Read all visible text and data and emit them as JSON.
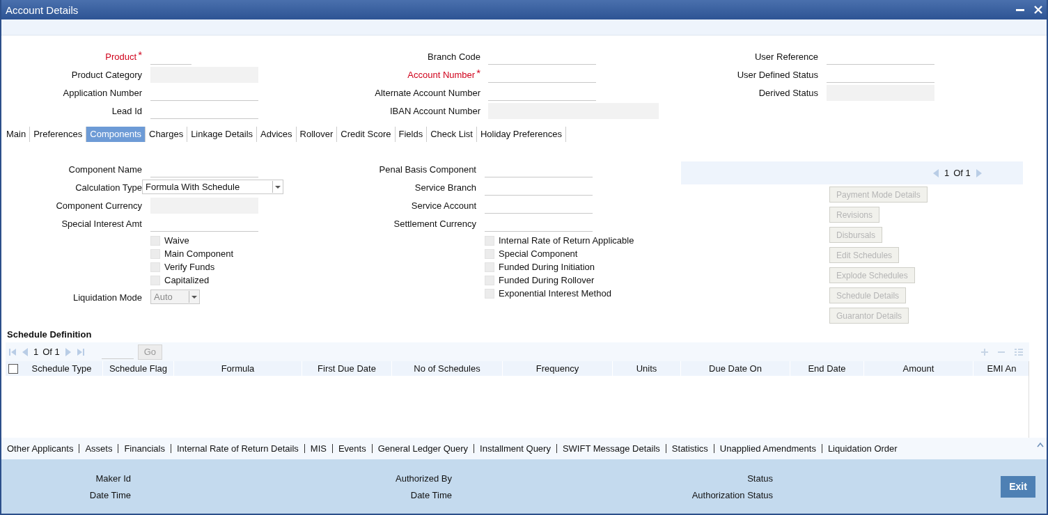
{
  "window": {
    "title": "Account Details"
  },
  "header": {
    "columns": [
      {
        "rows": [
          {
            "label": "Product",
            "mark": "*",
            "required": true,
            "disabled": false
          },
          {
            "label": "Product Category",
            "required": false,
            "disabled": true
          },
          {
            "label": "Application Number",
            "required": false,
            "disabled": false
          },
          {
            "label": "Lead Id",
            "required": false,
            "disabled": false
          }
        ]
      },
      {
        "rows": [
          {
            "label": "Branch Code",
            "required": false,
            "disabled": false
          },
          {
            "label": "Account Number",
            "mark": "*",
            "required": true,
            "disabled": false
          },
          {
            "label": "Alternate Account Number",
            "required": false,
            "disabled": false
          },
          {
            "label": "IBAN Account Number",
            "required": false,
            "disabled": true
          }
        ]
      },
      {
        "rows": [
          {
            "label": "User Reference",
            "required": false,
            "disabled": false
          },
          {
            "label": "User Defined Status",
            "required": false,
            "disabled": false
          },
          {
            "label": "Derived Status",
            "required": false,
            "disabled": true
          }
        ]
      }
    ]
  },
  "tabs": [
    {
      "label": "Main",
      "selected": false
    },
    {
      "label": "Preferences",
      "selected": false
    },
    {
      "label": "Components",
      "selected": true
    },
    {
      "label": "Charges",
      "selected": false
    },
    {
      "label": "Linkage Details",
      "selected": false
    },
    {
      "label": "Advices",
      "selected": false
    },
    {
      "label": "Rollover",
      "selected": false
    },
    {
      "label": "Credit Score",
      "selected": false
    },
    {
      "label": "Fields",
      "selected": false
    },
    {
      "label": "Check List",
      "selected": false
    },
    {
      "label": "Holiday Preferences",
      "selected": false
    }
  ],
  "components": {
    "left": [
      {
        "kind": "text",
        "label": "Component Name",
        "disabled": false
      },
      {
        "kind": "select",
        "label": "Calculation Type",
        "value": "Formula With Schedule",
        "disabled": false
      },
      {
        "kind": "text",
        "label": "Component Currency",
        "disabled": true
      },
      {
        "kind": "text",
        "label": "Special Interest Amt",
        "disabled": false
      },
      {
        "kind": "checkbox",
        "label": "Waive",
        "checked": false
      },
      {
        "kind": "checkbox",
        "label": "Main Component",
        "checked": false
      },
      {
        "kind": "checkbox",
        "label": "Verify Funds",
        "checked": false
      },
      {
        "kind": "checkbox",
        "label": "Capitalized",
        "checked": false
      },
      {
        "kind": "select",
        "label": "Liquidation Mode",
        "value": "Auto",
        "disabled": true
      }
    ],
    "middle": [
      {
        "kind": "text",
        "label": "Penal Basis Component",
        "disabled": false
      },
      {
        "kind": "text",
        "label": "Service Branch",
        "disabled": false
      },
      {
        "kind": "text",
        "label": "Service Account",
        "disabled": false
      },
      {
        "kind": "text",
        "label": "Settlement Currency",
        "disabled": false
      },
      {
        "kind": "checkbox",
        "label": "Internal Rate of Return Applicable",
        "checked": false
      },
      {
        "kind": "checkbox",
        "label": "Special Component",
        "checked": false
      },
      {
        "kind": "checkbox",
        "label": "Funded During Initiation",
        "checked": false
      },
      {
        "kind": "checkbox",
        "label": "Funded During Rollover",
        "checked": false
      },
      {
        "kind": "checkbox",
        "label": "Exponential Interest Method",
        "checked": false
      }
    ],
    "pager": {
      "current": "1",
      "of": "Of 1"
    },
    "buttons": [
      {
        "label": "Payment Mode Details",
        "disabled": true
      },
      {
        "label": "Revisions",
        "disabled": true
      },
      {
        "label": "Disbursals",
        "disabled": true
      },
      {
        "label": "Edit Schedules",
        "disabled": true
      },
      {
        "label": "Explode Schedules",
        "disabled": true
      },
      {
        "label": "Schedule Details",
        "disabled": true
      },
      {
        "label": "Guarantor Details",
        "disabled": true
      }
    ]
  },
  "schedule_definition": {
    "title": "Schedule Definition",
    "pager": {
      "current": "1",
      "of": "Of 1"
    },
    "go_button": "Go",
    "select_all_checked": false,
    "columns": [
      "Schedule Type",
      "Schedule Flag",
      "Formula",
      "First Due Date",
      "No of Schedules",
      "Frequency",
      "Units",
      "Due Date On",
      "End Date",
      "Amount",
      "EMI An"
    ]
  },
  "links": [
    "Other Applicants",
    "Assets",
    "Financials",
    "Internal Rate of Return Details",
    "MIS",
    "Events",
    "General Ledger Query",
    "Installment Query",
    "SWIFT Message Details",
    "Statistics",
    "Unapplied Amendments",
    "Liquidation Order"
  ],
  "audit": [
    [
      {
        "label": "Maker Id"
      },
      {
        "label": "Date Time"
      }
    ],
    [
      {
        "label": "Authorized By"
      },
      {
        "label": "Date Time"
      }
    ],
    [
      {
        "label": "Status"
      },
      {
        "label": "Authorization Status"
      }
    ]
  ],
  "exit_button": "Exit"
}
